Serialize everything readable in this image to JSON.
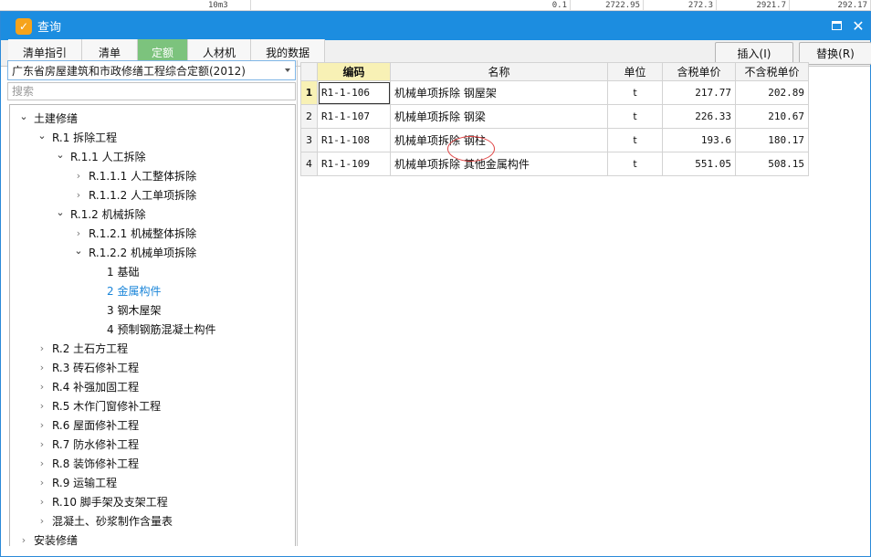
{
  "background": {
    "cells": [
      "10m3",
      "0.1",
      "2722.95",
      "272.3",
      "2921.7",
      "292.17"
    ]
  },
  "window": {
    "title": "查询",
    "icon": "query-app-icon",
    "maximize_icon": "maximize-icon",
    "close_icon": "close-icon",
    "close_glyph": "✕"
  },
  "tabs": [
    {
      "label": "清单指引",
      "active": false
    },
    {
      "label": "清单",
      "active": false
    },
    {
      "label": "定额",
      "active": true
    },
    {
      "label": "人材机",
      "active": false
    },
    {
      "label": "我的数据",
      "active": false
    }
  ],
  "toolbar": {
    "insert_label": "插入(I)",
    "replace_label": "替换(R)"
  },
  "left_panel": {
    "quota_select_value": "广东省房屋建筑和市政修缮工程综合定额(2012)",
    "search_placeholder": "搜索",
    "tree": [
      {
        "label": "土建修缮",
        "level": 0,
        "state": "open"
      },
      {
        "label": "R.1 拆除工程",
        "level": 1,
        "state": "open"
      },
      {
        "label": "R.1.1 人工拆除",
        "level": 2,
        "state": "open"
      },
      {
        "label": "R.1.1.1 人工整体拆除",
        "level": 3,
        "state": "closed"
      },
      {
        "label": "R.1.1.2 人工单项拆除",
        "level": 3,
        "state": "closed"
      },
      {
        "label": "R.1.2 机械拆除",
        "level": 2,
        "state": "open"
      },
      {
        "label": "R.1.2.1 机械整体拆除",
        "level": 3,
        "state": "closed"
      },
      {
        "label": "R.1.2.2 机械单项拆除",
        "level": 3,
        "state": "open"
      },
      {
        "label": "1 基础",
        "level": 4,
        "state": "leaf"
      },
      {
        "label": "2 金属构件",
        "level": 4,
        "state": "leaf",
        "selected": true
      },
      {
        "label": "3 钢木屋架",
        "level": 4,
        "state": "leaf"
      },
      {
        "label": "4 预制钢筋混凝土构件",
        "level": 4,
        "state": "leaf"
      },
      {
        "label": "R.2 土石方工程",
        "level": 1,
        "state": "closed"
      },
      {
        "label": "R.3 砖石修补工程",
        "level": 1,
        "state": "closed"
      },
      {
        "label": "R.4 补强加固工程",
        "level": 1,
        "state": "closed"
      },
      {
        "label": "R.5 木作门窗修补工程",
        "level": 1,
        "state": "closed"
      },
      {
        "label": "R.6 屋面修补工程",
        "level": 1,
        "state": "closed"
      },
      {
        "label": "R.7 防水修补工程",
        "level": 1,
        "state": "closed"
      },
      {
        "label": "R.8 装饰修补工程",
        "level": 1,
        "state": "closed"
      },
      {
        "label": "R.9 运输工程",
        "level": 1,
        "state": "closed"
      },
      {
        "label": "R.10 脚手架及支架工程",
        "level": 1,
        "state": "closed"
      },
      {
        "label": "混凝土、砂浆制作含量表",
        "level": 1,
        "state": "closed"
      },
      {
        "label": "安装修缮",
        "level": 0,
        "state": "closed"
      }
    ]
  },
  "grid": {
    "headers": {
      "index": "",
      "code": "编码",
      "name": "名称",
      "unit": "单位",
      "tax_price": "含税单价",
      "notax_price": "不含税单价"
    },
    "rows": [
      {
        "index": "1",
        "code": "R1-1-106",
        "name": "机械单项拆除 钢屋架",
        "unit": "t",
        "tax_price": "217.77",
        "notax_price": "202.89"
      },
      {
        "index": "2",
        "code": "R1-1-107",
        "name": "机械单项拆除 钢梁",
        "unit": "t",
        "tax_price": "226.33",
        "notax_price": "210.67"
      },
      {
        "index": "3",
        "code": "R1-1-108",
        "name": "机械单项拆除 钢柱",
        "unit": "t",
        "tax_price": "193.6",
        "notax_price": "180.17"
      },
      {
        "index": "4",
        "code": "R1-1-109",
        "name": "机械单项拆除 其他金属构件",
        "unit": "t",
        "tax_price": "551.05",
        "notax_price": "508.15"
      }
    ]
  }
}
